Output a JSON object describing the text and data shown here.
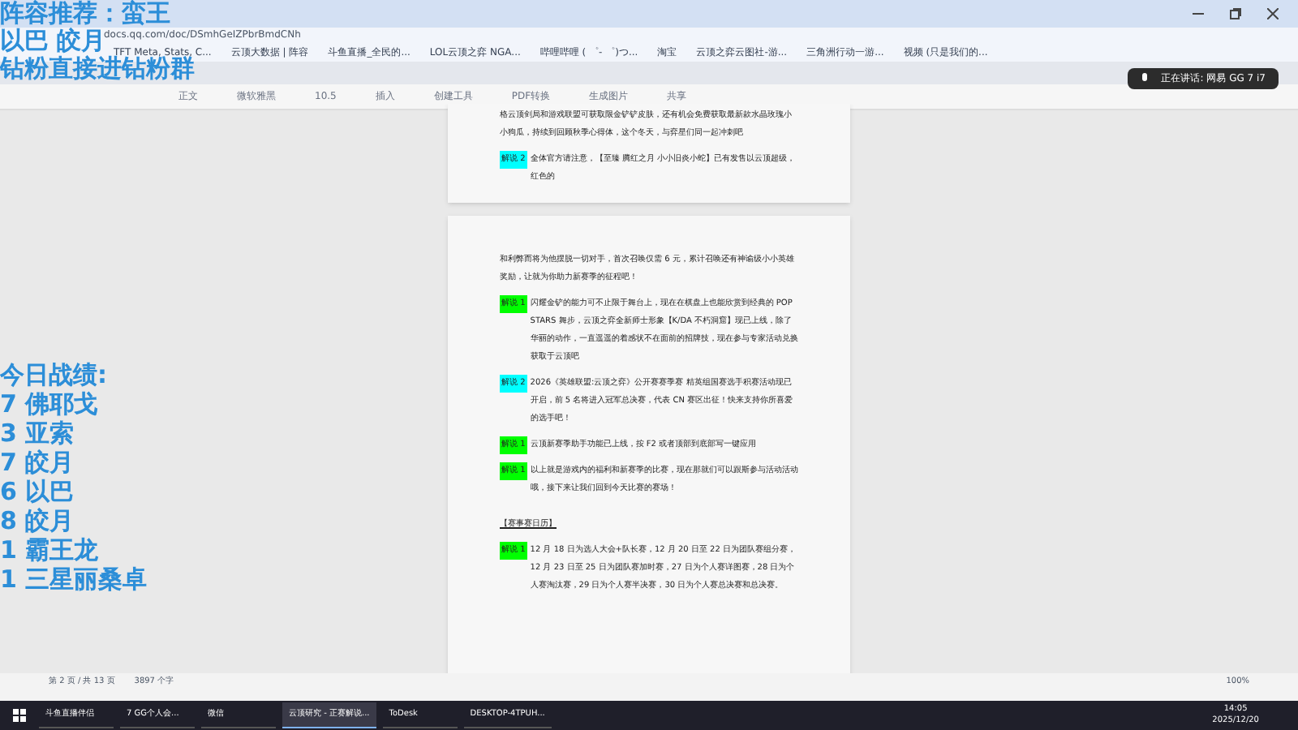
{
  "browser": {
    "url": "docs.qq.com/doc/DSmhGeIZPbrBmdCNh",
    "bookmarks": [
      "TFT Meta, Stats, C...",
      "云顶大数据 | 阵容",
      "斗鱼直播_全民的...",
      "LOL云顶之弈 NGA...",
      "哔哩哔哩 ( ゜- ゜)つ...",
      "淘宝",
      "云顶之弈云图社-游...",
      "三角洲行动一游...",
      "视频 (只是我们的..."
    ]
  },
  "toolbar": {
    "items": [
      "正文",
      "微软雅黑",
      "10.5",
      "插入",
      "创建工具",
      "PDF转换",
      "生成图片",
      "共享"
    ]
  },
  "voice_popup": {
    "text": "正在讲话: 网易 GG 7 i7"
  },
  "pages": [
    {
      "paragraphs": [
        {
          "text": "格云顶剑局和游戏联盟可获取限金铲铲皮肤，还有机会免费获取最新款水晶玫瑰小小狗瓜，持续到回顾秋季心得体，这个冬天，与弈星们同一起冲刺吧"
        },
        {
          "label": "解说 2",
          "color": "#00ffff",
          "text": "全体官方请注意，【至臻 腾红之月 小小旧炎小蛇】已有发售以云顶超级，红色的"
        }
      ]
    },
    {
      "paragraphs": [
        {
          "text": "和利弊而将为他摆脱一切对手，首次召唤仅需 6 元，累计召唤还有神谕级小小英雄奖励，让就为你助力新赛季的征程吧！"
        },
        {
          "label": "解说 1",
          "color": "#00ff00",
          "text": "闪耀金铲的能力可不止限于舞台上，现在在棋盘上也能欣赏到经典的 POP STARS 舞步，云顶之弈全新师士形象【K/DA 不朽洞窟】现已上线，除了华丽的动作，一直遥遥的着感状不在面前的招牌技，现在参与专家活动兑换获取于云顶吧"
        },
        {
          "label": "解说 2",
          "color": "#00ffff",
          "text": "2026《英雄联盟:云顶之弈》公开赛赛季赛 精英组国赛选手积赛活动现已开启，前 5 名将进入冠军总决赛，代表 CN 赛区出征！快来支持你所喜爱的选手吧！"
        },
        {
          "label": "解说 1",
          "color": "#00ff00",
          "text": "云顶新赛季助手功能已上线，按 F2 或者顶部到底部写一键应用"
        },
        {
          "label": "解说 1",
          "color": "#00ff00",
          "text": "以上就是游戏内的福利和新赛季的比赛，现在那就们可以跟斯参与活动活动哦，接下来让我们回到今天比赛的赛场！"
        },
        {
          "heading": "【赛事赛日历】"
        },
        {
          "label": "解说 1",
          "color": "#00ff00",
          "text": "12 月 18 日为选人大会+队长赛，12 月 20 日至 22 日为团队赛组分赛，12 月 23 日至 25 日为团队赛加时赛，27 日为个人赛详图赛，28 日为个人赛淘汰赛，29 日为个人赛半决赛，30 日为个人赛总决赛和总决赛。"
        }
      ]
    }
  ],
  "status_bar": {
    "page": "第 2 页 / 共 13 页",
    "words": "3897 个字",
    "zoom": "100%"
  },
  "taskbar": {
    "apps": [
      {
        "label": "斗鱼直播伴侣",
        "active": false
      },
      {
        "label": "7 GG个人会...",
        "active": false
      },
      {
        "label": "微信",
        "active": false
      },
      {
        "label": "云顶研究 - 正赛解说...",
        "active": true
      },
      {
        "label": "ToDesk",
        "active": false
      },
      {
        "label": "DESKTOP-4TPUH...",
        "active": false
      }
    ],
    "time": "14:05",
    "date": "2025/12/20"
  },
  "overlay": {
    "lineup": [
      "阵容推荐：蛮王",
      "以巴 皎月",
      "钻粉直接进钻粉群"
    ],
    "record_title": "今日战绩:",
    "records": [
      "7 佛耶戈",
      "3 亚索",
      "7 皎月",
      "6 以巴",
      "8 皎月",
      "1 霸王龙",
      "1 三星丽桑卓"
    ]
  }
}
